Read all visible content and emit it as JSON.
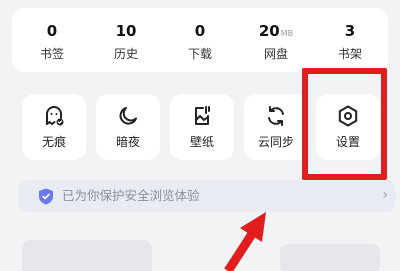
{
  "stats": [
    {
      "value": "0",
      "unit": "",
      "label": "书签"
    },
    {
      "value": "10",
      "unit": "",
      "label": "历史"
    },
    {
      "value": "0",
      "unit": "",
      "label": "下载"
    },
    {
      "value": "20",
      "unit": "MB",
      "label": "网盘"
    },
    {
      "value": "3",
      "unit": "",
      "label": "书架"
    }
  ],
  "tools": [
    {
      "label": "无痕",
      "icon": "ghost-icon"
    },
    {
      "label": "暗夜",
      "icon": "moon-icon"
    },
    {
      "label": "壁纸",
      "icon": "wallpaper-icon"
    },
    {
      "label": "云同步",
      "icon": "sync-icon"
    },
    {
      "label": "设置",
      "icon": "settings-hexagon-icon"
    }
  ],
  "security": {
    "text": "已为你保护安全浏览体验",
    "icon": "shield-check-icon"
  },
  "colors": {
    "highlight": "#e21d1d",
    "shield": "#6b78f0",
    "card": "#ffffff",
    "background": "#f2f3f5"
  }
}
